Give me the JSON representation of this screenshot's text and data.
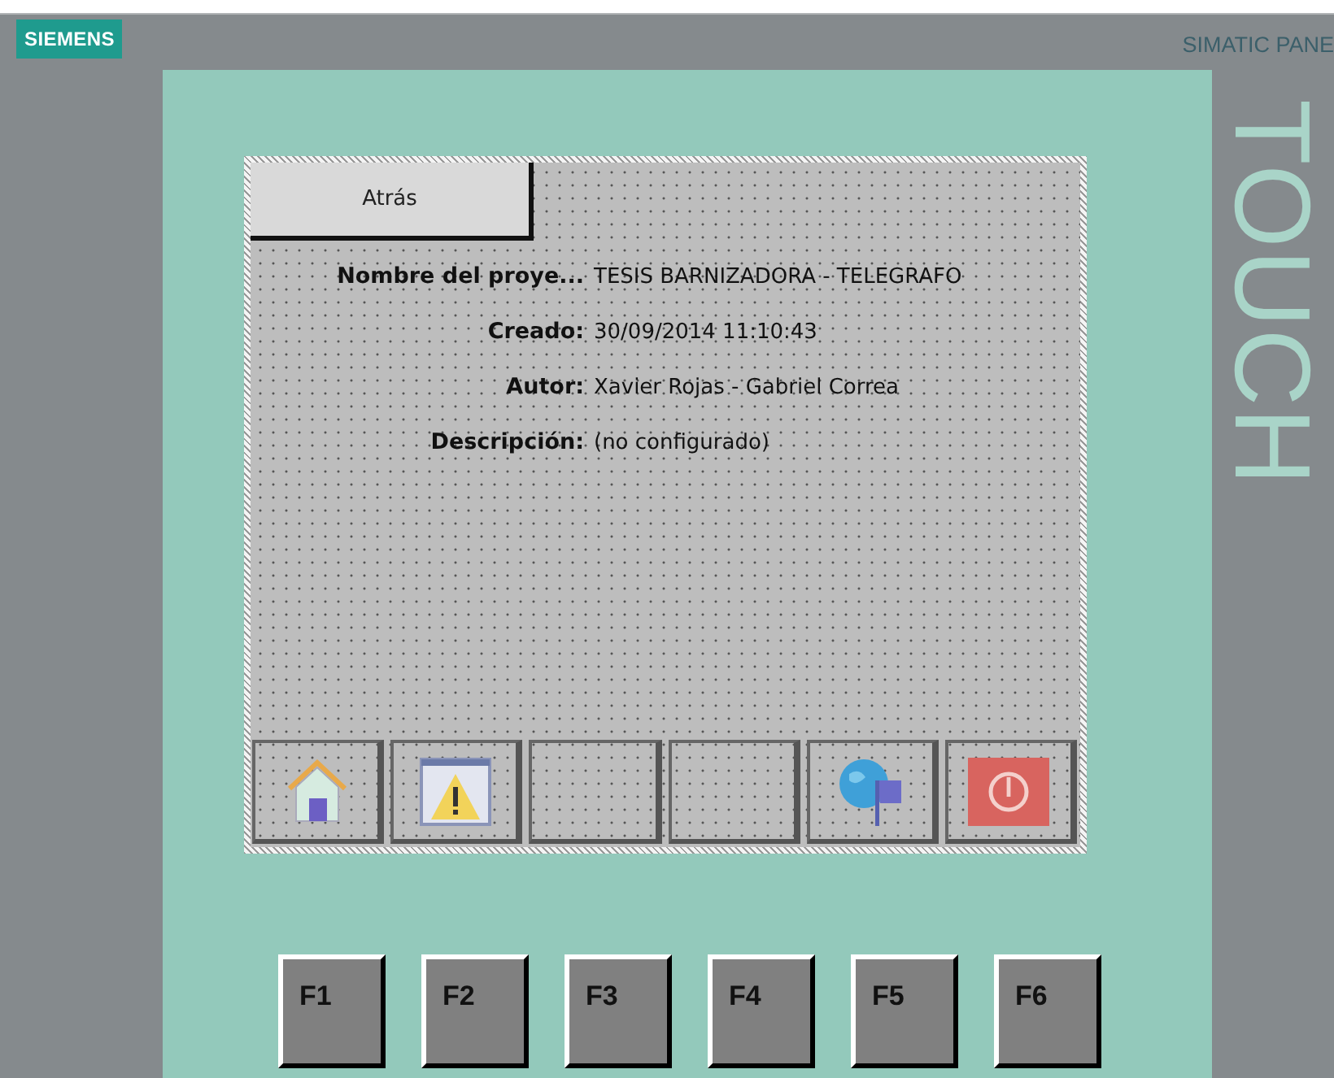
{
  "brand": "SIEMENS",
  "model_label": "SIMATIC PANE",
  "side_label": "TOUCH",
  "back_button": {
    "label": "Atrás"
  },
  "fields": [
    {
      "label": "Nombre del proye...",
      "value": "TESIS BARNIZADORA - TELEGRAFO"
    },
    {
      "label": "Creado:",
      "value": "30/09/2014 11:10:43"
    },
    {
      "label": "Autor:",
      "value": "Xavier Rojas - Gabriel Correa"
    },
    {
      "label": "Descripción:",
      "value": "(no configurado)"
    }
  ],
  "screen_buttons": [
    {
      "kind": "home"
    },
    {
      "kind": "alarm"
    },
    {
      "kind": "empty"
    },
    {
      "kind": "empty"
    },
    {
      "kind": "language"
    },
    {
      "kind": "power"
    }
  ],
  "function_keys": [
    "F1",
    "F2",
    "F3",
    "F4",
    "F5",
    "F6"
  ]
}
